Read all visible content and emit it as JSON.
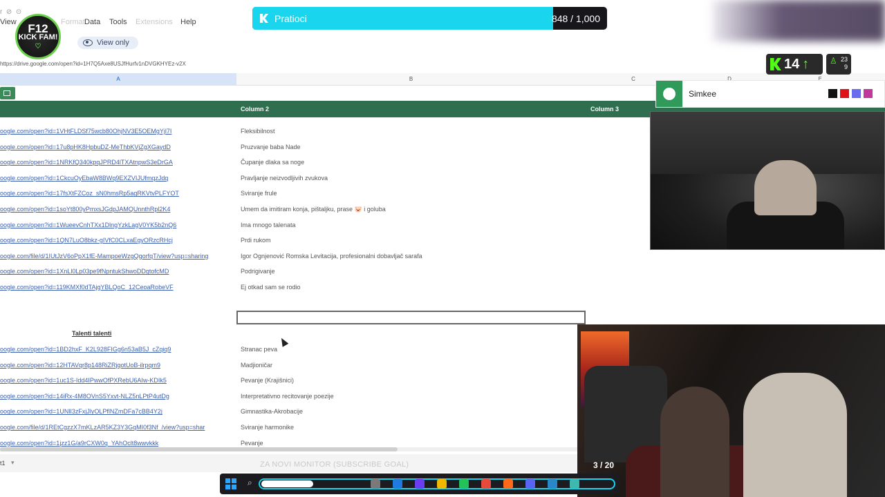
{
  "sheets": {
    "menu": {
      "view": "View",
      "format": "Format",
      "data": "Data",
      "tools": "Tools",
      "extensions": "Extensions",
      "help": "Help"
    },
    "view_only": "View only",
    "url": "https://drive.google.com/open?id=1H7Q5Axe8USJfHurfv1nDVGKHYEz-v2X",
    "columns": {
      "a": "A",
      "b": "B",
      "c": "C",
      "d": "D",
      "e": "E"
    },
    "header": {
      "col2": "Column 2",
      "col3": "Column 3"
    },
    "rows": [
      {
        "link": "oogle.com/open?id=1VHtFLDSf75wcb80OhjNV3E5OEMgYjl7I",
        "desc": "Fleksibilnost"
      },
      {
        "link": "oogle.com/open?id=17u8pHK8HpbuDZ-MeThbKVjZgXGaydD",
        "desc": "Pruzvanje baba Nade"
      },
      {
        "link": "oogle.com/open?id=1NRKfQ340kpqJPRD4lTXAtnpwS3eDrGA",
        "desc": "Čupanje dlaka sa noge"
      },
      {
        "link": "oogle.com/open?id=1CkcuOyEbaW8BWq9EXZVIJUfmqzJdq",
        "desc": "Pravljanje neizvodljivih zvukova"
      },
      {
        "link": "oogle.com/open?id=17fsXtFZCoz_sN0hmsRp5agRKVtvPLFYOT",
        "desc": "Sviranje frule"
      },
      {
        "link": "oogle.com/open?id=1soYt800yPmxsJGdpJAMQUnnthRpl2K4",
        "desc": "Umem da imitiram konja, pištaljku, prase 🐷 i goluba"
      },
      {
        "link": "oogle.com/open?id=1WueevCnhTXx1DlngYzkLagV0YK5b2nQ6",
        "desc": "Ima mnogo talenata"
      },
      {
        "link": "oogle.com/open?id=1QN7LuO8bkz-gIVfC0CLxaEgyORzcRHcj",
        "desc": "Prdi rukom"
      },
      {
        "link": "oogle.com/file/d/1IUtJzV6oPpX1fE-MampoeWzgQgorfqT/view?usp=sharing",
        "desc": "Igor Ognjenović Romska Levitacija, profesionalni dobavljač sarafa"
      },
      {
        "link": "oogle.com/open?id=1XnLl0Lp03pe9fNpntukShwoDDgtofcMD",
        "desc": "Podrigivanje"
      },
      {
        "link": "oogle.com/open?id=119KMXf0dTAjgYBLQoC_12CeoaRobeVF",
        "desc": "Ej otkad sam se rodio"
      }
    ],
    "section_title": "Talenti talenti",
    "rows2": [
      {
        "link": "oogle.com/open?id=1BD2hxF_K2L928FIGg6n53aB5J_cZqiq9",
        "desc": "Stranac peva"
      },
      {
        "link": "oogle.com/open?id=12HTAVqr8p148RiZRjqotUoB-ilrpqm9",
        "desc": "Madjioničar"
      },
      {
        "link": "oogle.com/open?id=1uc1S-Idd4IPwwOfPXRebU6AIw-KDIk5",
        "desc": "Pevanje (Krajišnici)"
      },
      {
        "link": "oogle.com/open?id=14iRx-4M8OVnS5Yxvt-NLZ5nLPtP4utDg",
        "desc": "Interpretativno recitovanje poezije"
      },
      {
        "link": "oogle.com/open?id=1UNlI3zFxjJlyOLPflNZmDFa7cBB4Y2j",
        "desc": "Gimnastika-Akrobacije"
      },
      {
        "link": "oogle.com/file/d/1REtCgzzX7mKLzAR5KZ3Y3GqMI0f3Nf_/view?usp=shar",
        "desc": "Sviranje harmonike"
      },
      {
        "link": "oogle.com/open?id=1jzz1G/a9rCXW0q_YAhOclt8wwvkkk",
        "desc": "Pevanje"
      }
    ],
    "sheet_tab": "t1"
  },
  "overlay": {
    "logo": {
      "line1": "F12",
      "line2": "KICK FAM!"
    },
    "followers": {
      "label": "Pratioci",
      "count": "848 / 1,000",
      "progress": 0.848
    },
    "kick_viewers": "14",
    "mini_stats": {
      "top": "23",
      "bottom": "9"
    },
    "spotify": {
      "name": "Simkee",
      "swatches": [
        "#111111",
        "#e0101a",
        "#6a6cf0",
        "#c0389a"
      ]
    },
    "subgoal": "ZA NOVI MONITOR (SUBSCRIBE GOAL)",
    "subgoal_counter": "3 / 20"
  },
  "colors": {
    "accent": "#19d6ee",
    "kick_green": "#53fc18",
    "sheet_green": "#2f6f4f",
    "link": "#3c5fb0"
  }
}
